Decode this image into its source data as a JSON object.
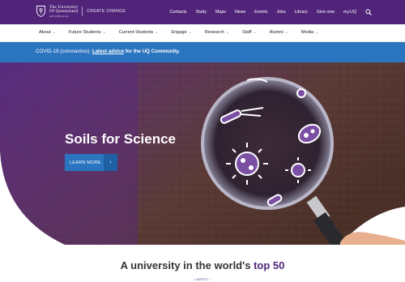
{
  "header": {
    "logo_line1": "The University",
    "logo_line2": "Of Queensland",
    "logo_line3": "AUSTRALIA",
    "tagline": "CREATE CHANGE",
    "links": [
      "Contacts",
      "Study",
      "Maps",
      "News",
      "Events",
      "Jobs",
      "Library",
      "Give now",
      "my.UQ"
    ]
  },
  "nav": {
    "items": [
      "About",
      "Future Students",
      "Current Students",
      "Engage",
      "Research",
      "Staff",
      "Alumni",
      "Media"
    ]
  },
  "alert": {
    "prefix": "COVID-19 (coronavirus): ",
    "link": "Latest advice",
    "suffix": " for the UQ Community."
  },
  "hero": {
    "title": "Soils for Science",
    "button": "LEARN MORE",
    "arrow": "›"
  },
  "intro": {
    "headline_prefix": "A university in the world's ",
    "headline_accent": "top 50",
    "link": "LATEST ›"
  },
  "colors": {
    "brand_purple": "#51247a",
    "alert_blue": "#2b74c0"
  }
}
